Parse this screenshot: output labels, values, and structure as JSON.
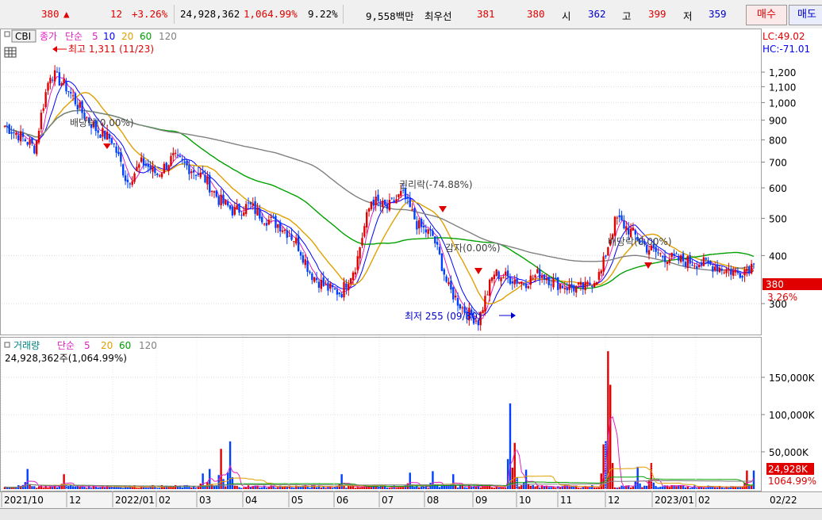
{
  "quote_bar": {
    "price": "380",
    "arrow": "▲",
    "change": "12",
    "change_pct": "+3.26%",
    "volume": "24,928,362",
    "volume_ratio": "1,064.99%",
    "turnover": "9.22%",
    "amount": "9,558백만",
    "best_offer_label": "최우선",
    "best_ask": "381",
    "best_bid": "380",
    "open_label": "시",
    "open": "362",
    "high_label": "고",
    "high": "399",
    "low_label": "저",
    "low": "359",
    "buy_button": "매수",
    "sell_button": "매도"
  },
  "price_panel": {
    "symbol": "CBI",
    "indicator_name": "종가",
    "ma_type": "단순",
    "ma_periods": [
      "5",
      "10",
      "20",
      "60",
      "120"
    ],
    "ma_colors": [
      "#e020c0",
      "#0000ff",
      "#e0a000",
      "#00a000",
      "#808080"
    ],
    "lc_label": "LC:49.02",
    "hc_label": "HC:-71.01",
    "current_price_tag": "380",
    "current_change_tag": "3.26%",
    "annotations": {
      "high": "최고 1,311 (11/23)",
      "low": "최저 255 (09/30)",
      "dividend_1": "배당락(0.00%)",
      "rights": "권리락(-74.88%)",
      "reduction": "감자(0.00%)",
      "dividend_2": "배당락(0.00%)"
    }
  },
  "volume_panel": {
    "indicator_name": "거래량",
    "ma_type": "단순",
    "ma_periods": [
      "5",
      "20",
      "60",
      "120"
    ],
    "ma_colors": [
      "#e020c0",
      "#e0a000",
      "#00a000",
      "#808080"
    ],
    "info": "24,928,362주(1,064.99%)",
    "current_volume_tag": "24,928K",
    "current_ratio_tag": "1064.99%"
  },
  "x_axis": {
    "labels": [
      "2021/10",
      "12",
      "2022/01",
      "02",
      "03",
      "04",
      "05",
      "06",
      "07",
      "08",
      "09",
      "10",
      "11",
      "12",
      "2023/01",
      "02"
    ],
    "cursor_date": "02/22"
  },
  "chart_data": [
    {
      "type": "candlestick",
      "yscale": "log",
      "ylim": [
        255,
        1311
      ],
      "yticks": [
        300,
        400,
        500,
        600,
        700,
        800,
        900,
        1000,
        1100,
        1200
      ],
      "ytick_labels": [
        "300",
        "400",
        "500",
        "600",
        "700",
        "800",
        "900",
        "1,000",
        "1,100",
        "1,200"
      ],
      "x_months": [
        "2021/10",
        "2021/11",
        "2021/12",
        "2022/01",
        "2022/02",
        "2022/03",
        "2022/04",
        "2022/05",
        "2022/06",
        "2022/07",
        "2022/08",
        "2022/09",
        "2022/10",
        "2022/11",
        "2022/12",
        "2023/01",
        "2023/02"
      ],
      "close_path": [
        870,
        820,
        760,
        1200,
        1100,
        950,
        850,
        800,
        620,
        700,
        650,
        720,
        680,
        640,
        560,
        520,
        540,
        500,
        480,
        440,
        360,
        330,
        320,
        380,
        560,
        530,
        580,
        480,
        450,
        330,
        290,
        270,
        360,
        350,
        340,
        360,
        340,
        330,
        330,
        360,
        500,
        460,
        420,
        400,
        390,
        385,
        380,
        370,
        360,
        380
      ],
      "max_high": 1311,
      "min_low": 255,
      "last": {
        "open": 362,
        "high": 399,
        "low": 359,
        "close": 380
      }
    },
    {
      "type": "bar",
      "yticks": [
        50000,
        100000,
        150000
      ],
      "ytick_labels": [
        "50,000K",
        "100,000K",
        "150,000K"
      ],
      "unit": "K",
      "last_value": 24928,
      "spikes": [
        {
          "pos": 0.03,
          "value": 27000
        },
        {
          "pos": 0.08,
          "value": 20000
        },
        {
          "pos": 0.265,
          "value": 21000
        },
        {
          "pos": 0.275,
          "value": 27000
        },
        {
          "pos": 0.29,
          "value": 38000
        },
        {
          "pos": 0.29,
          "value": 54000
        },
        {
          "pos": 0.3,
          "value": 64000
        },
        {
          "pos": 0.45,
          "value": 20000
        },
        {
          "pos": 0.54,
          "value": 22000
        },
        {
          "pos": 0.57,
          "value": 24000
        },
        {
          "pos": 0.598,
          "value": 20000
        },
        {
          "pos": 0.675,
          "value": 115000
        },
        {
          "pos": 0.68,
          "value": 62000
        },
        {
          "pos": 0.695,
          "value": 26000
        },
        {
          "pos": 0.8,
          "value": 60000
        },
        {
          "pos": 0.805,
          "value": 185000
        },
        {
          "pos": 0.81,
          "value": 140000
        },
        {
          "pos": 0.845,
          "value": 30000
        },
        {
          "pos": 0.862,
          "value": 35000
        },
        {
          "pos": 0.99,
          "value": 24928
        }
      ]
    }
  ]
}
